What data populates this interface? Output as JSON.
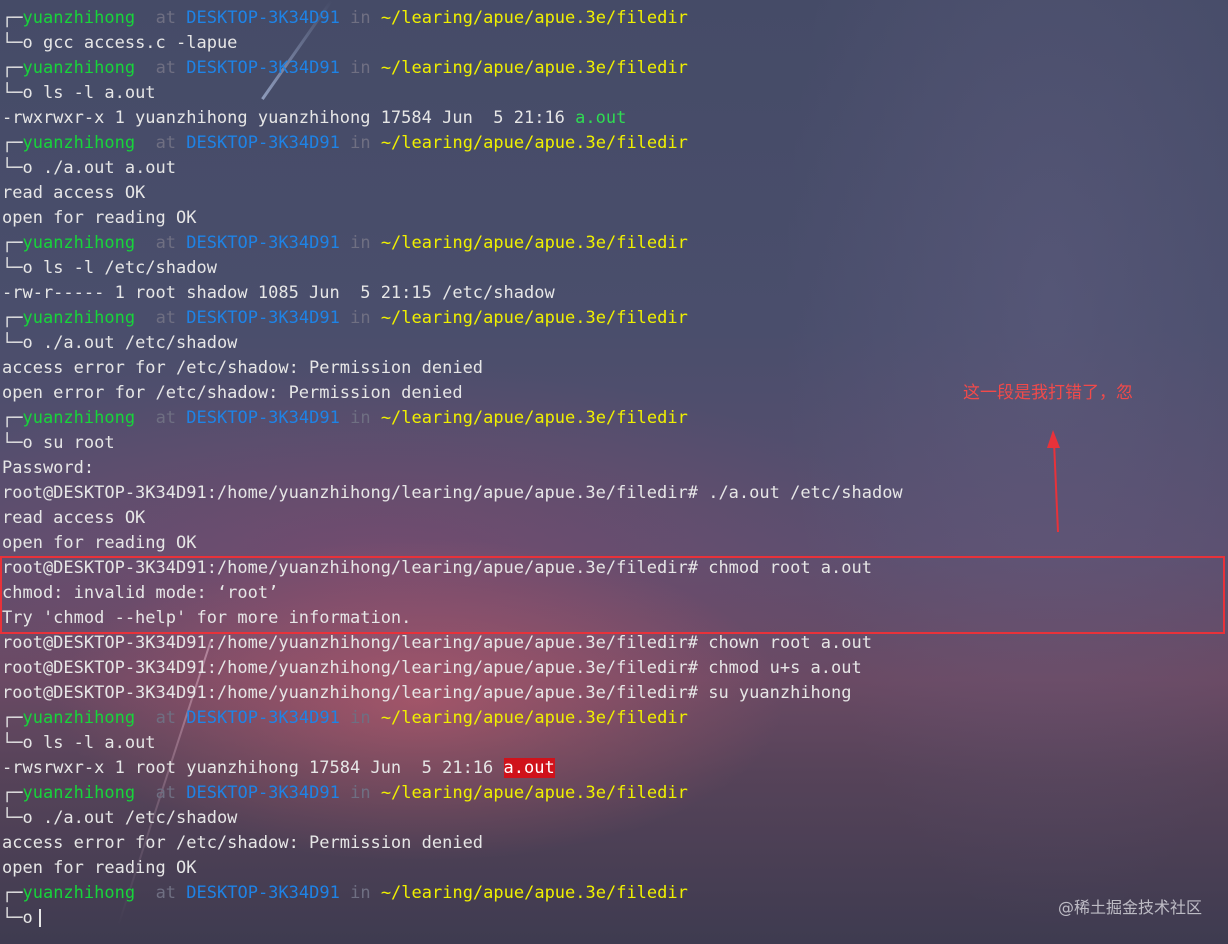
{
  "prompt": {
    "user": "yuanzhihong",
    "at": "at",
    "host": "DESKTOP-3K34D91",
    "in": "in",
    "path": "~/learing/apue/apue.3e/filedir",
    "top_glyph": "┌─",
    "bottom_glyph": "└─o"
  },
  "lines": {
    "l1_cmd": " gcc access.c -lapue",
    "l2_cmd": " ls -l a.out",
    "l2_out_pre": "-rwxrwxr-x 1 yuanzhihong yuanzhihong 17584 Jun  5 21:16 ",
    "l2_out_file": "a.out",
    "l3_cmd": " ./a.out a.out",
    "l3_out1": "read access OK",
    "l3_out2": "open for reading OK",
    "l4_cmd": " ls -l /etc/shadow",
    "l4_out": "-rw-r----- 1 root shadow 1085 Jun  5 21:15 /etc/shadow",
    "l5_cmd": " ./a.out /etc/shadow",
    "l5_out1": "access error for /etc/shadow: Permission denied",
    "l5_out2": "open error for /etc/shadow: Permission denied",
    "l6_cmd": " su root",
    "l6_out1": "Password:",
    "root1": "root@DESKTOP-3K34D91:/home/yuanzhihong/learing/apue/apue.3e/filedir# ./a.out /etc/shadow",
    "root1_out1": "read access OK",
    "root1_out2": "open for reading OK",
    "root2": "root@DESKTOP-3K34D91:/home/yuanzhihong/learing/apue/apue.3e/filedir# chmod root a.out",
    "root2_out1": "chmod: invalid mode: ‘root’",
    "root2_out2": "Try 'chmod --help' for more information.",
    "root3": "root@DESKTOP-3K34D91:/home/yuanzhihong/learing/apue/apue.3e/filedir# chown root a.out",
    "root4": "root@DESKTOP-3K34D91:/home/yuanzhihong/learing/apue/apue.3e/filedir# chmod u+s a.out",
    "root5": "root@DESKTOP-3K34D91:/home/yuanzhihong/learing/apue/apue.3e/filedir# su yuanzhihong",
    "l7_cmd": " ls -l a.out",
    "l7_out_pre": "-rwsrwxr-x 1 root yuanzhihong 17584 Jun  5 21:16 ",
    "l7_out_file": "a.out",
    "l8_cmd": " ./a.out /etc/shadow",
    "l8_out1": "access error for /etc/shadow: Permission denied",
    "l8_out2": "open for reading OK"
  },
  "annotation": {
    "note": "这一段是我打错了，忽",
    "color": "#f24a4a"
  },
  "watermark": "@稀土掘金技术社区",
  "colors": {
    "user": "#17d43a",
    "host": "#1e83e6",
    "path": "#f0f000",
    "highlight": "#d0121b",
    "text": "#e6e6e6"
  }
}
